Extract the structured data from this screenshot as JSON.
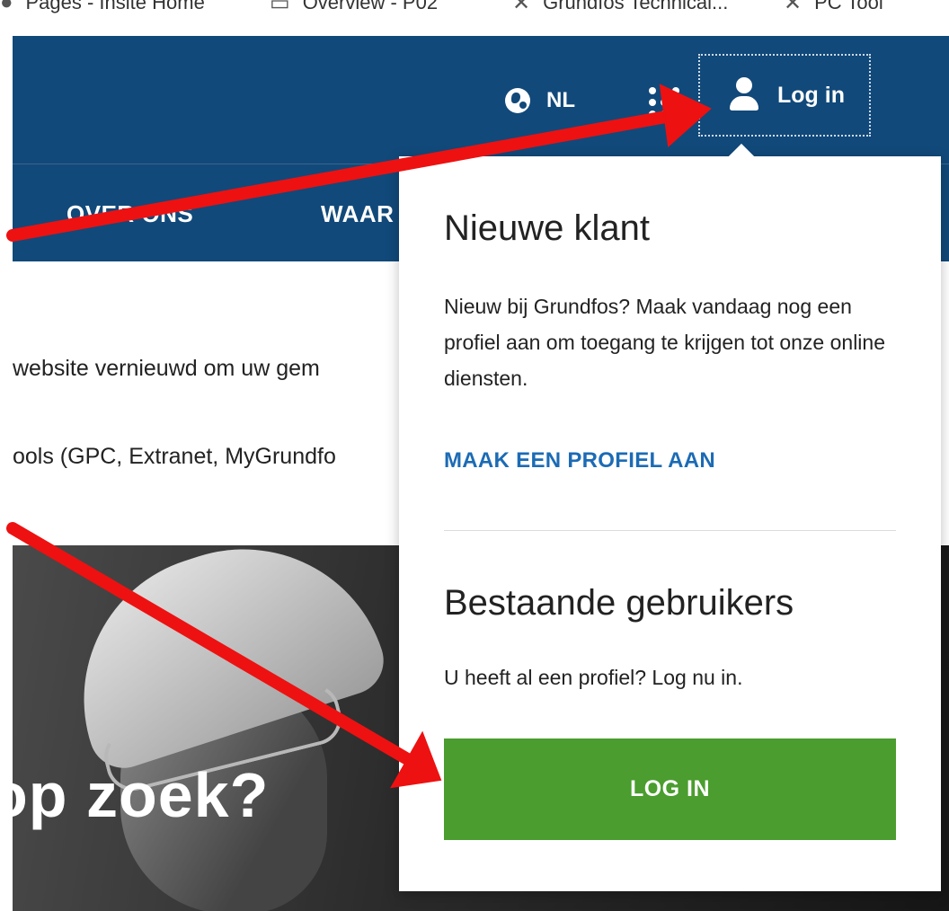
{
  "bookmarks": [
    {
      "label": "Pages - Insite Home",
      "icon": "globe-icon"
    },
    {
      "label": "Overview - P02",
      "icon": "chart-icon"
    },
    {
      "label": "Grundfos Technical...",
      "icon": "grundfos-icon"
    },
    {
      "label": "PC Tool",
      "icon": "grundfos-icon"
    }
  ],
  "header": {
    "language": "NL",
    "login_label": "Log in",
    "nav_items": [
      "OVER ONS",
      "WAAR"
    ]
  },
  "intro": {
    "line1": "website vernieuwd om uw gem",
    "line2": "ools (GPC, Extranet, MyGrundfo"
  },
  "hero": {
    "title": "op zoek?"
  },
  "login_popup": {
    "new_customer_heading": "Nieuwe klant",
    "new_customer_text": "Nieuw bij Grundfos? Maak vandaag nog een profiel aan om toegang te krijgen tot onze online diensten.",
    "create_profile_link": "MAAK EEN PROFIEL AAN",
    "existing_users_heading": "Bestaande gebruikers",
    "existing_users_text": "U heeft al een profiel? Log nu in.",
    "login_button": "LOG IN"
  },
  "colors": {
    "header_blue": "#11497a",
    "link_blue": "#1c6bb5",
    "button_green": "#4a9d2e",
    "annotation_arrow_red": "#ee1111"
  }
}
